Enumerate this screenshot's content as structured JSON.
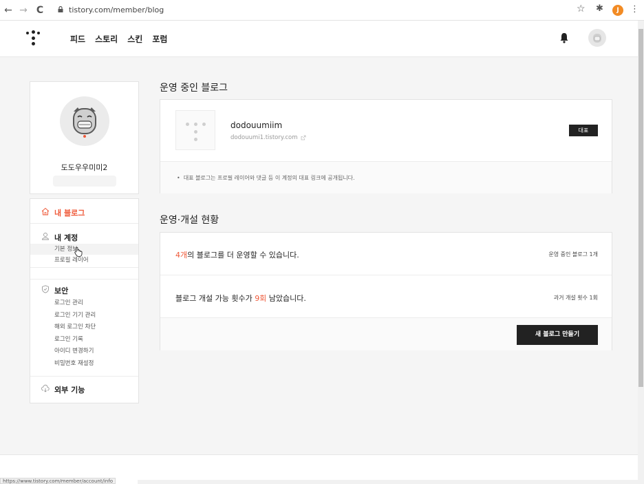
{
  "browser": {
    "back_icon": "←",
    "forward_icon": "→",
    "reload_icon": "C",
    "url": "tistory.com/member/blog",
    "star_icon": "☆",
    "extensions_icon": "✱",
    "profile_initial": "J",
    "menu_icon": "⋮",
    "status_url": "https://www.tistory.com/member/account/info"
  },
  "header": {
    "nav": [
      "피드",
      "스토리",
      "스킨",
      "포럼"
    ]
  },
  "profile": {
    "name": "도도우우미미2"
  },
  "sidebar": {
    "my_blog": "내 블로그",
    "account": {
      "title": "내 계정",
      "items": [
        "기본 정보",
        "프로필 레이어"
      ]
    },
    "security": {
      "title": "보안",
      "items": [
        "로그인 관리",
        "로그인 기기 관리",
        "해외 로그인 차단",
        "로그인 기록",
        "아이디 변경하기",
        "비밀번호 재설정"
      ]
    },
    "external": "외부 기능"
  },
  "blogs_section": {
    "title": "운영 중인 블로그",
    "blog_name": "dodouumiim",
    "blog_url": "dodouumi1.tistory.com",
    "badge": "대표",
    "notice": "대표 블로그는 프로필 레이어와 댓글 등 이 계정의 대표 링크에 공개됩니다."
  },
  "status_section": {
    "title": "운영·개설 현황",
    "row1": {
      "highlight": "4개",
      "text": "의 블로그를 더 운영할 수 있습니다.",
      "side": "운영 중인 블로그 1개"
    },
    "row2": {
      "prefix": "블로그 개설 가능 횟수가 ",
      "highlight": "9회",
      "suffix": " 남았습니다.",
      "side": "과거 개설 횟수 1회"
    },
    "new_button": "새 블로그 만들기"
  },
  "colors": {
    "accent": "#ef5a3a",
    "dark": "#222222"
  }
}
